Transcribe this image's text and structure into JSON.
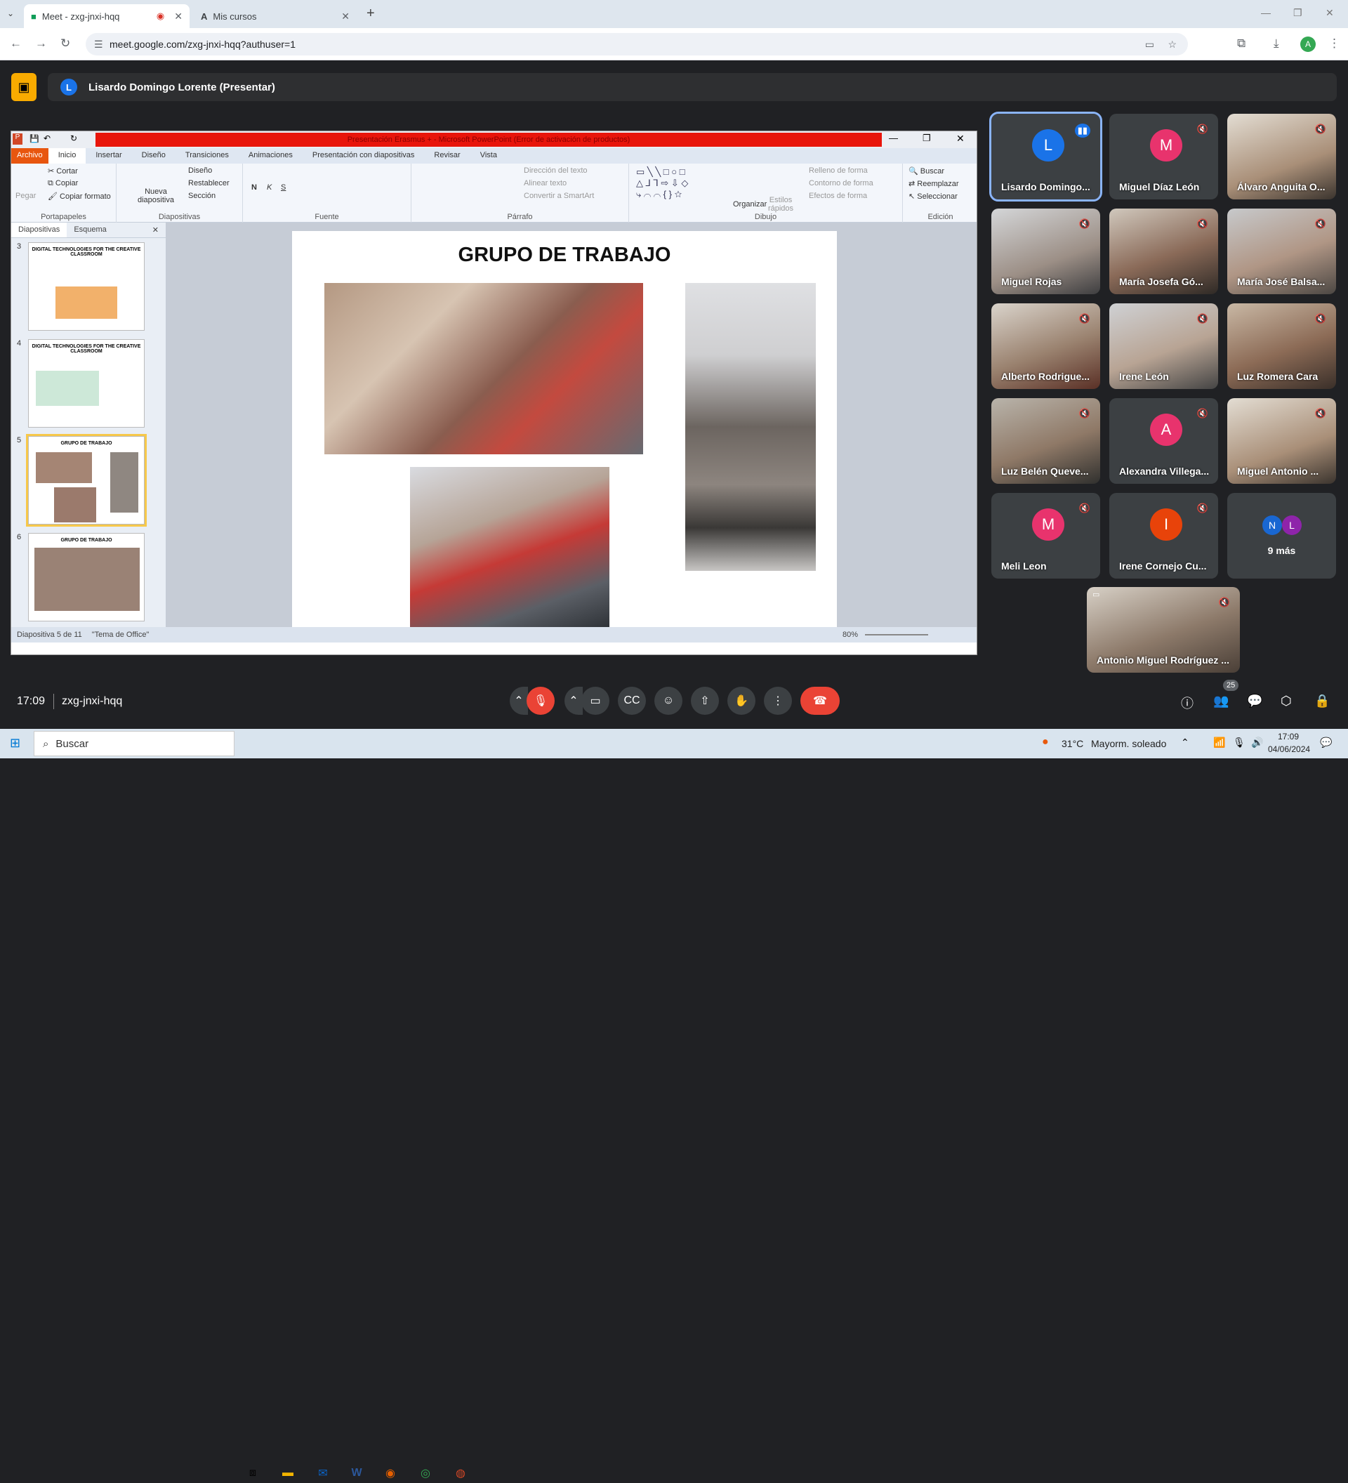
{
  "browser": {
    "tabs": [
      {
        "label": "Meet - zxg-jnxi-hqq"
      },
      {
        "label": "Mis cursos"
      }
    ],
    "url": "meet.google.com/zxg-jnxi-hqq?authuser=1",
    "profile_initial": "A"
  },
  "meet": {
    "presenter_initial": "L",
    "presenter_banner": "Lisardo Domingo Lorente (Presentar)",
    "time": "17:09",
    "meeting_code": "zxg-jnxi-hqq",
    "people_count": "25",
    "more_label": "9 más",
    "more_initials": [
      "N",
      "L"
    ],
    "participants": [
      {
        "name": "Lisardo Domingo...",
        "initial": "L",
        "color": "#1a73e8",
        "speaking": true
      },
      {
        "name": "Miguel Díaz León",
        "initial": "M",
        "color": "#e8336d"
      },
      {
        "name": "Álvaro Anguita O..."
      },
      {
        "name": "Miguel Rojas"
      },
      {
        "name": "María Josefa Gó..."
      },
      {
        "name": "María José Balsa..."
      },
      {
        "name": "Alberto Rodrigue..."
      },
      {
        "name": "Irene León"
      },
      {
        "name": "Luz Romera Cara"
      },
      {
        "name": "Luz Belén Queve..."
      },
      {
        "name": "Alexandra Villega...",
        "initial": "A",
        "color": "#e8336d"
      },
      {
        "name": "Miguel Antonio ..."
      },
      {
        "name": "Meli Leon",
        "initial": "M",
        "color": "#e8336d"
      },
      {
        "name": "Irene Cornejo Cu...",
        "initial": "I",
        "color": "#e8430a"
      },
      {
        "name": "Antonio Miguel Rodríguez ..."
      }
    ]
  },
  "ppt": {
    "window_title": "Presentación Erasmus + - Microsoft PowerPoint (Error de activación de productos)",
    "ribbon_tabs": [
      "Archivo",
      "Inicio",
      "Insertar",
      "Diseño",
      "Transiciones",
      "Animaciones",
      "Presentación con diapositivas",
      "Revisar",
      "Vista"
    ],
    "clipboard": {
      "paste": "Pegar",
      "cut": "Cortar",
      "copy": "Copiar",
      "copy_format": "Copiar formato",
      "label": "Portapapeles"
    },
    "slides_group": {
      "new_slide": "Nueva diapositiva",
      "layout": "Diseño",
      "reset": "Restablecer",
      "section": "Sección",
      "label": "Diapositivas"
    },
    "font_label": "Fuente",
    "paragraph": {
      "text_dir": "Dirección del texto",
      "align_text": "Alinear texto",
      "smartart": "Convertir a SmartArt",
      "label": "Párrafo"
    },
    "drawing": {
      "arrange": "Organizar",
      "quick_styles": "Estilos rápidos",
      "fill": "Relleno de forma",
      "outline": "Contorno de forma",
      "effects": "Efectos de forma",
      "label": "Dibujo"
    },
    "editing": {
      "find": "Buscar",
      "replace": "Reemplazar",
      "select": "Seleccionar",
      "label": "Edición"
    },
    "panel_tabs": [
      "Diapositivas",
      "Esquema"
    ],
    "thumbnails": [
      {
        "num": "3",
        "title": "DIGITAL TECHNOLOGIES FOR THE CREATIVE CLASSROOM"
      },
      {
        "num": "4",
        "title": "DIGITAL TECHNOLOGIES FOR THE CREATIVE CLASSROOM"
      },
      {
        "num": "5",
        "title": "GRUPO DE TRABAJO"
      },
      {
        "num": "6",
        "title": "GRUPO DE TRABAJO"
      }
    ],
    "slide_title": "GRUPO DE TRABAJO",
    "status_slide": "Diapositiva 5 de 11",
    "status_theme": "\"Tema de Office\"",
    "zoom": "80%"
  },
  "taskbar": {
    "search": "Buscar",
    "temp": "31°C",
    "weather": "Mayorm. soleado",
    "clock_time": "17:09",
    "clock_date": "04/06/2024"
  }
}
